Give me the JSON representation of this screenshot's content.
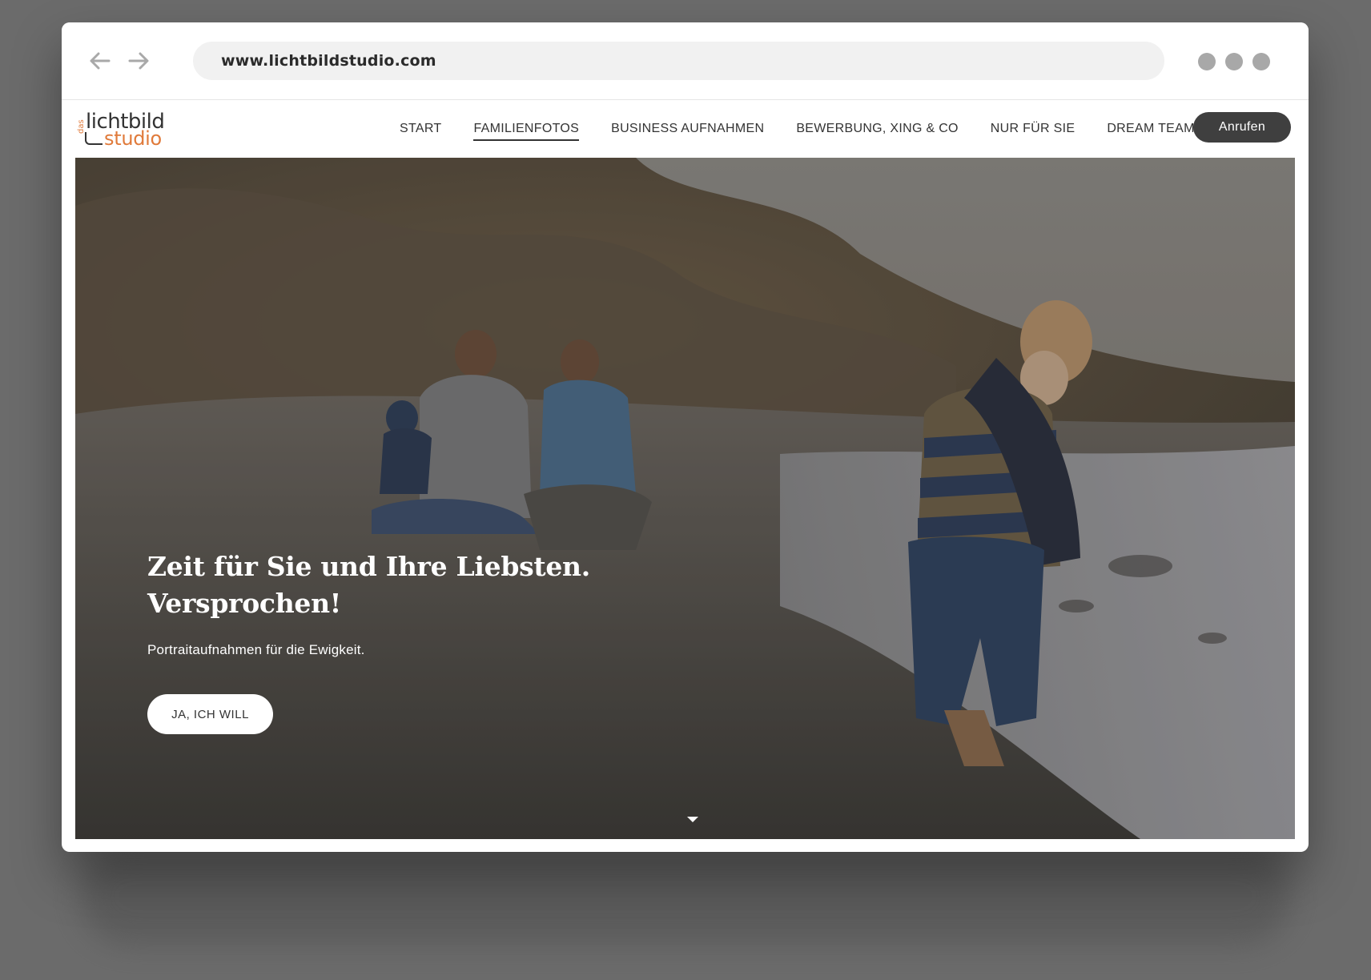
{
  "browser": {
    "url": "www.lichtbildstudio.com",
    "back_icon": "arrow-left-icon",
    "forward_icon": "arrow-right-icon"
  },
  "logo": {
    "top": "das",
    "line1": "lichtbild",
    "line2": "studio",
    "accent_color": "#e07a3a"
  },
  "nav": {
    "items": [
      {
        "label": "START"
      },
      {
        "label": "FAMILIENFOTOS",
        "active": true
      },
      {
        "label": "BUSINESS AUFNAHMEN"
      },
      {
        "label": "BEWERBUNG, XING & CO"
      },
      {
        "label": "NUR FÜR SIE"
      },
      {
        "label": "DREAM TEAM"
      }
    ],
    "call_label": "Anrufen"
  },
  "hero": {
    "title_line1": "Zeit für Sie und Ihre Liebsten.",
    "title_line2": "Versprochen!",
    "subtitle": "Portraitaufnahmen für die Ewigkeit.",
    "cta_label": "JA, ICH WILL",
    "scroll_icon": "caret-down-icon"
  }
}
